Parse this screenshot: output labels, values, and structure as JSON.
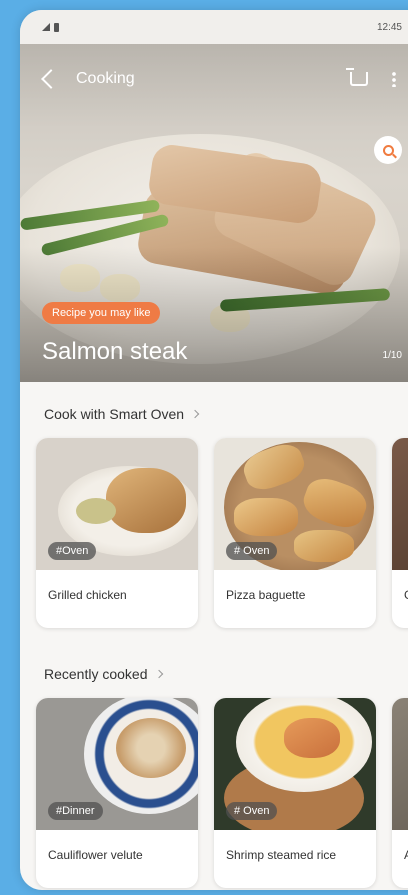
{
  "status_bar": {
    "time": "12:45"
  },
  "header": {
    "title": "Cooking"
  },
  "hero": {
    "badge": "Recipe you may like",
    "name": "Salmon steak",
    "page_indicator": "1/10"
  },
  "smart_oven": {
    "title": "Cook with Smart Oven",
    "cards": [
      {
        "tag": "#Oven",
        "label": "Grilled chicken"
      },
      {
        "tag": "# Oven",
        "label": "Pizza baguette"
      },
      {
        "tag": "",
        "label": "Gri"
      }
    ]
  },
  "recent": {
    "title": "Recently cooked",
    "cards": [
      {
        "tag": "#Dinner",
        "label": "Cauliflower velute"
      },
      {
        "tag": "# Oven",
        "label": "Shrimp steamed rice"
      },
      {
        "tag": "",
        "label": "Asp"
      }
    ]
  },
  "colors": {
    "accent": "#ef7b45",
    "background": "#5aaee6"
  },
  "icons": [
    "back-icon",
    "cart-icon",
    "more-icon",
    "search-icon",
    "chevron-right-icon"
  ]
}
